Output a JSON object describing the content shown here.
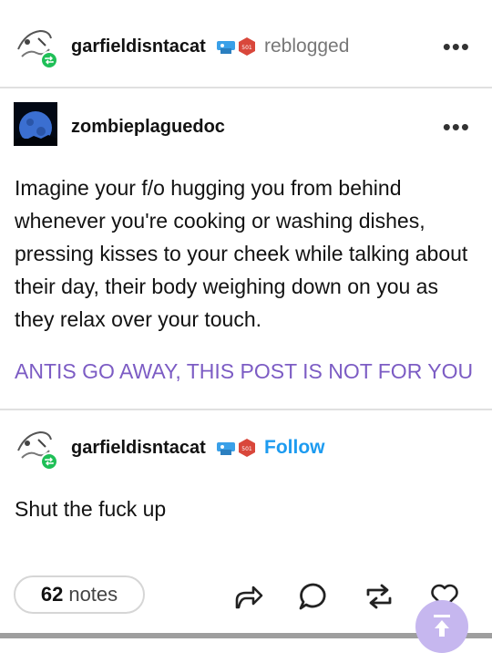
{
  "reblog_header": {
    "username": "garfieldisntacat",
    "action": "reblogged"
  },
  "original_post": {
    "username": "zombieplaguedoc",
    "body": "Imagine your f/o hugging you from behind whenever you're cooking or washing dishes, pressing kisses to your cheek while talking about their day, their body weighing down on you as they relax over your touch.",
    "tag_line": "ANTIS GO AWAY, THIS POST IS NOT FOR YOU"
  },
  "reply": {
    "username": "garfieldisntacat",
    "follow_label": "Follow",
    "body": "Shut the fuck up"
  },
  "footer": {
    "notes_count": "62",
    "notes_label": "notes"
  },
  "colors": {
    "accent_blue": "#1d9bf0",
    "tag_purple": "#7c5cc4",
    "reblog_green": "#1fbf57",
    "fab_lavender": "#c6b7ef"
  },
  "icons": [
    "more-options-icon",
    "reblog-badge-icon",
    "share-icon",
    "reply-icon",
    "reblog-icon",
    "like-icon",
    "scroll-to-top-icon"
  ]
}
